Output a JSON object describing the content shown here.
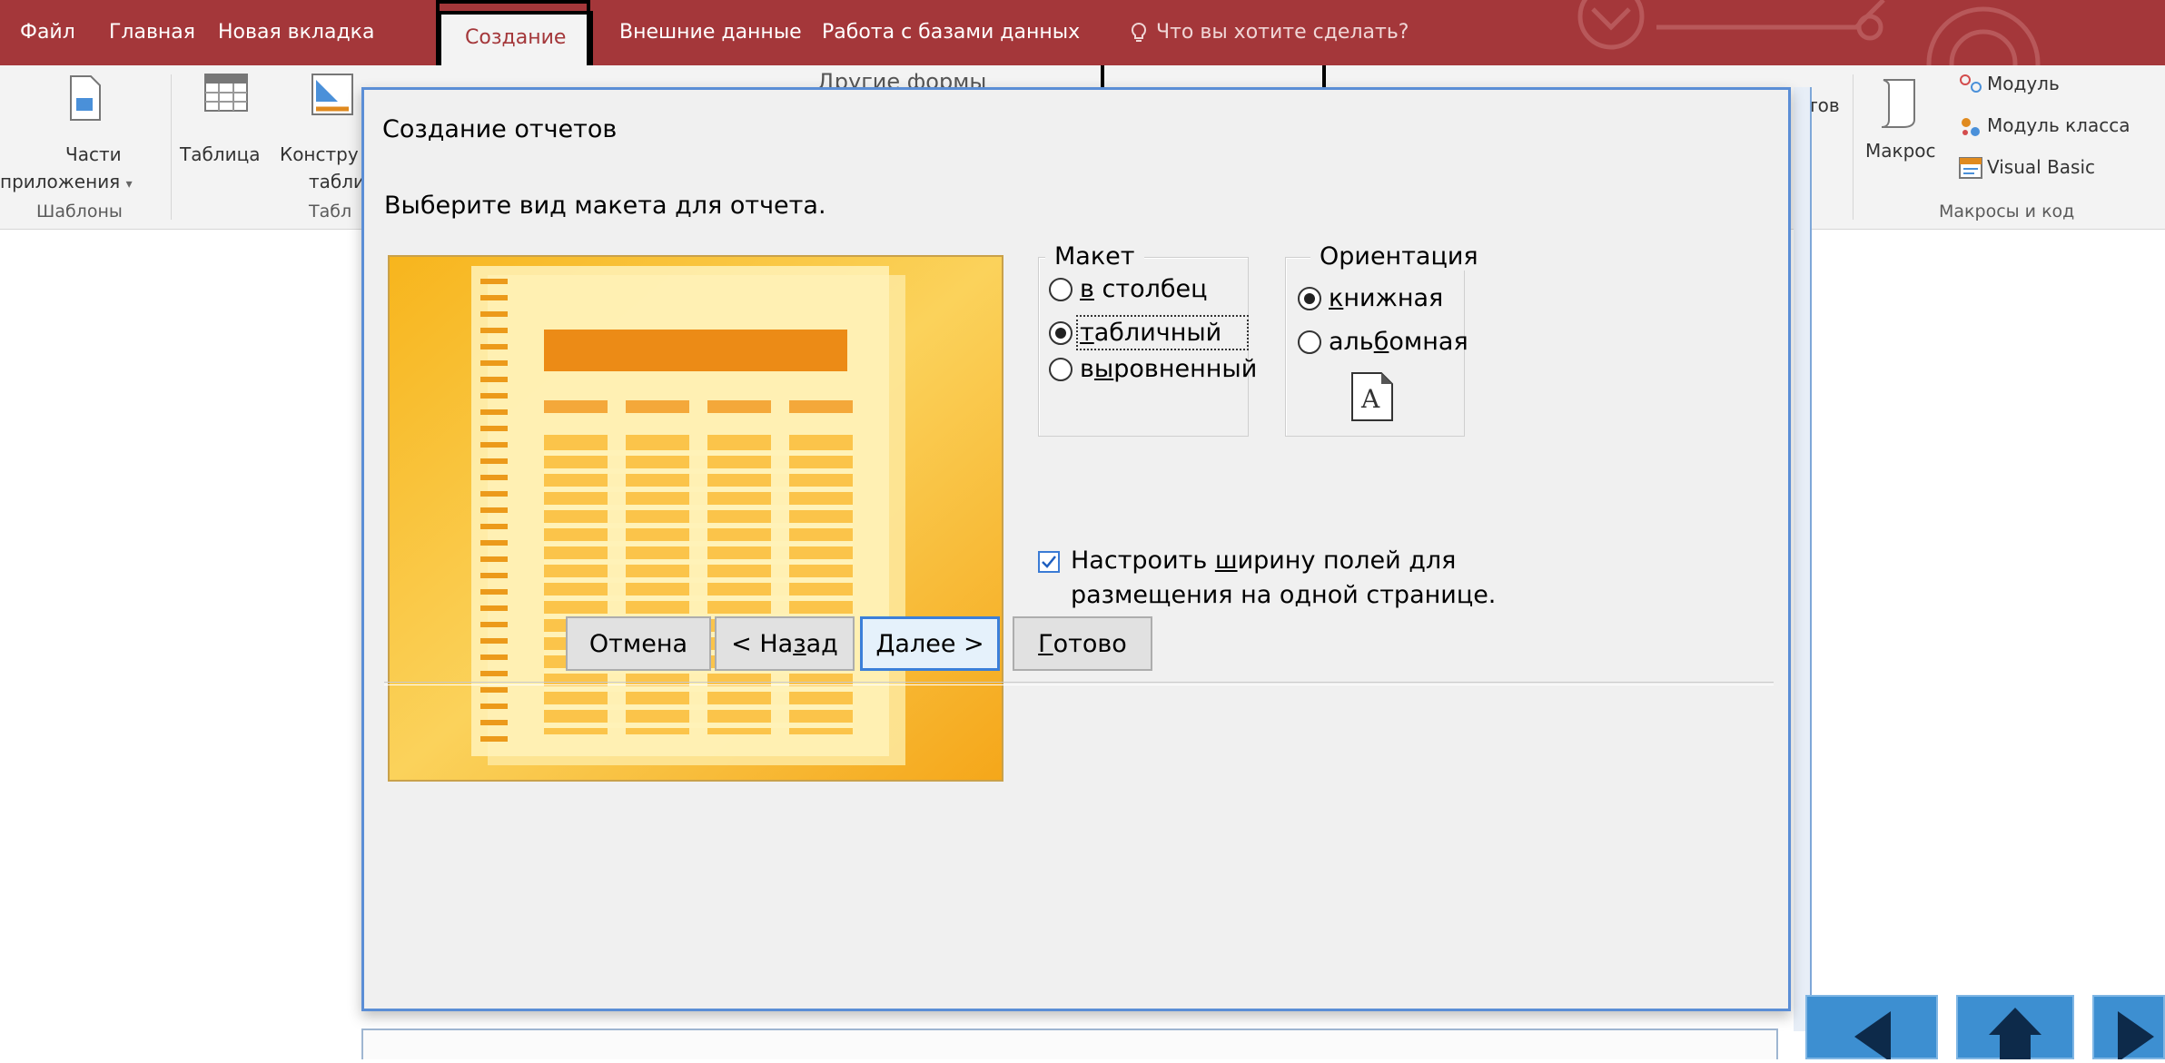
{
  "tabs": {
    "file": "Файл",
    "home": "Главная",
    "new_tab": "Новая вкладка",
    "create": "Создание",
    "external": "Внешние данные",
    "database_tools": "Работа с базами данных",
    "tell_me": "Что вы хотите сделать?"
  },
  "ribbon": {
    "app_parts_line1": "Части",
    "app_parts_line2": "приложения",
    "app_parts_arrow": "▾",
    "group_templates": "Шаблоны",
    "table": "Таблица",
    "constructor_line1": "Констру",
    "constructor_line2": "табли",
    "group_tables": "Табл",
    "other_forms": "Другие формы",
    "reports_partial": "тов",
    "macro": "Макрос",
    "module": "Модуль",
    "class_module": "Модуль класса",
    "visual_basic": "Visual Basic",
    "group_macros": "Макросы и код"
  },
  "dialog": {
    "title": "Создание отчетов",
    "prompt": "Выберите вид макета для отчета.",
    "layout_legend": "Макет",
    "layout_options": {
      "columnar_ul": "в",
      "columnar_rest": " столбец",
      "tabular_ul": "т",
      "tabular_rest": "абличный",
      "justified_pre": "в",
      "justified_ul": "ы",
      "justified_rest": "ровненный"
    },
    "layout_selected": "табличный",
    "orientation_legend": "Ориентация",
    "orientation_options": {
      "portrait_ul": "к",
      "portrait_rest": "нижная",
      "landscape_pre": "аль",
      "landscape_ul": "б",
      "landscape_rest": "омная"
    },
    "orientation_selected": "книжная",
    "page_glyph": "A",
    "fit_pre": "Настроить ",
    "fit_ul": "ш",
    "fit_rest": "ирину полей для размещения на одной странице.",
    "fit_checked": true,
    "buttons": {
      "cancel": "Отмена",
      "back_pre": "< На",
      "back_ul": "з",
      "back_rest": "ад",
      "next_ul": "Д",
      "next_rest": "алее >",
      "finish_ul": "Г",
      "finish_rest": "отово"
    }
  },
  "colors": {
    "title_bar": "#a4373a",
    "ribbon": "#f3f3f3",
    "dialog_border": "#5b8ed6",
    "preview_orange": "#f5b21f",
    "nav_blue": "#3d8fd1"
  },
  "icons": [
    "app-parts-icon",
    "table-icon",
    "table-design-icon",
    "macro-icon",
    "module-icon",
    "class-module-icon",
    "visual-basic-icon",
    "page-portrait-icon",
    "lightbulb-icon",
    "checkmark-icon",
    "back-arrow-icon",
    "home-arrow-icon",
    "forward-arrow-icon"
  ]
}
